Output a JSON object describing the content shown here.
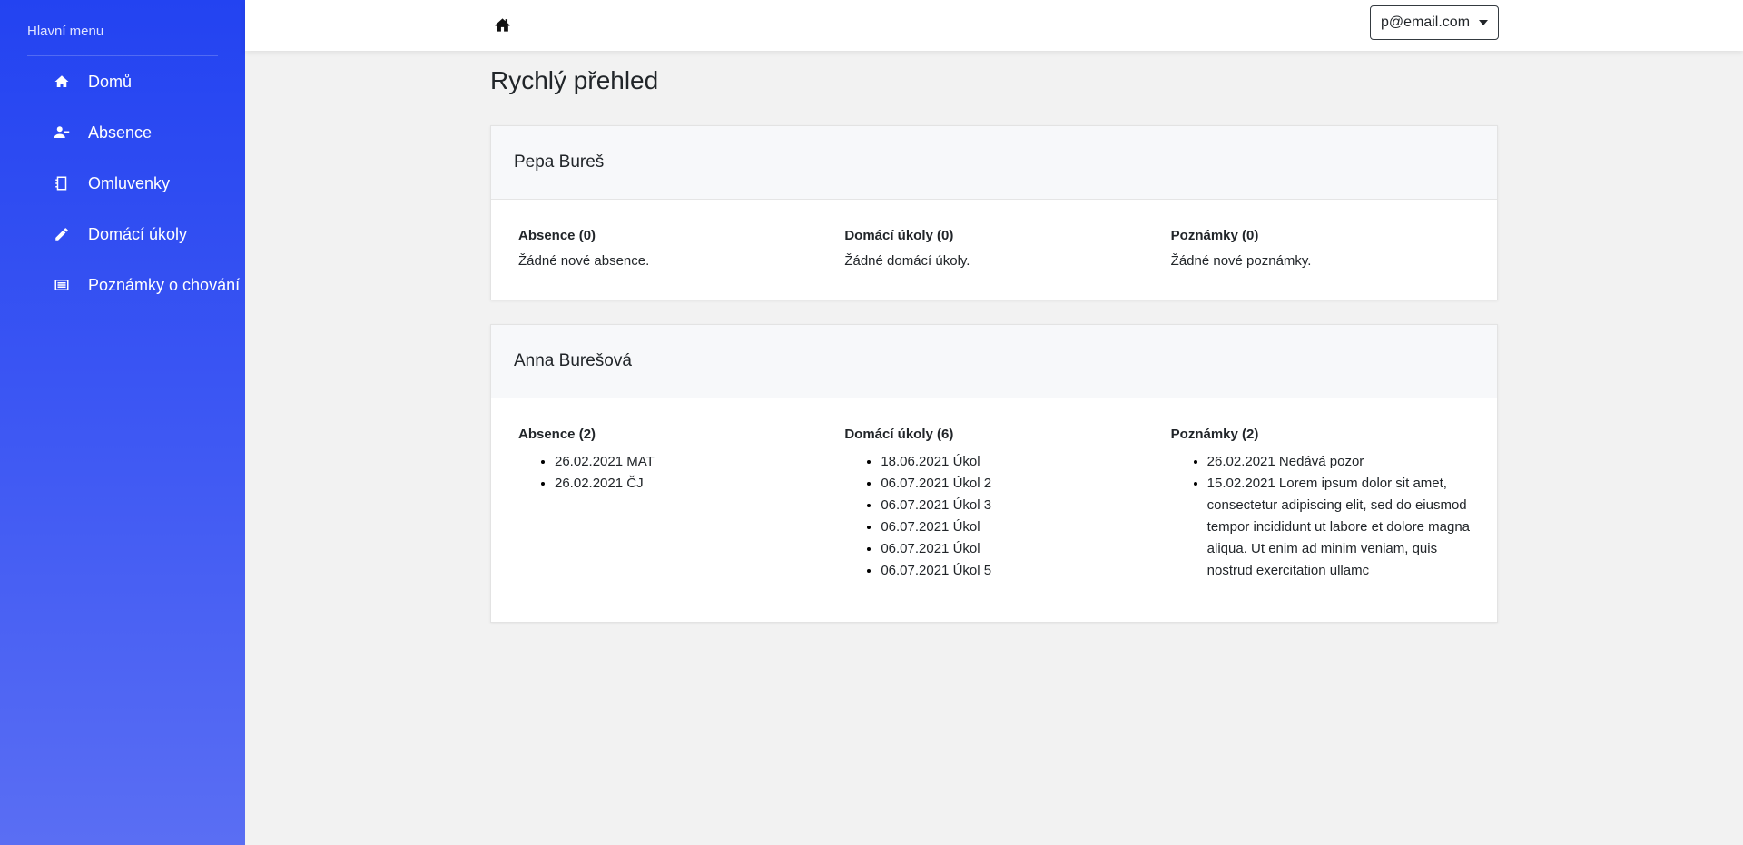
{
  "sidebar": {
    "title": "Hlavní menu",
    "items": [
      {
        "label": "Domů",
        "icon": "home-icon"
      },
      {
        "label": "Absence",
        "icon": "user-minus-icon"
      },
      {
        "label": "Omluvenky",
        "icon": "notebook-icon"
      },
      {
        "label": "Domácí úkoly",
        "icon": "pencil-icon"
      },
      {
        "label": "Poznámky o chování",
        "icon": "list-icon"
      }
    ]
  },
  "topbar": {
    "home_icon": "home-icon",
    "user_email": "p@email.com"
  },
  "main": {
    "title": "Rychlý přehled",
    "students": [
      {
        "name": "Pepa Bureš",
        "absence": {
          "heading": "Absence (0)",
          "empty": "Žádné nové absence.",
          "items": []
        },
        "homework": {
          "heading": "Domácí úkoly (0)",
          "empty": "Žádné domácí úkoly.",
          "items": []
        },
        "notes": {
          "heading": "Poznámky (0)",
          "empty": "Žádné nové poznámky.",
          "items": []
        }
      },
      {
        "name": "Anna Burešová",
        "absence": {
          "heading": "Absence (2)",
          "items": [
            "26.02.2021 MAT",
            "26.02.2021 ČJ"
          ]
        },
        "homework": {
          "heading": "Domácí úkoly (6)",
          "items": [
            "18.06.2021 Úkol",
            "06.07.2021 Úkol 2",
            "06.07.2021 Úkol 3",
            "06.07.2021 Úkol",
            "06.07.2021 Úkol",
            "06.07.2021 Úkol 5"
          ]
        },
        "notes": {
          "heading": "Poznámky (2)",
          "items": [
            "26.02.2021 Nedává pozor",
            "15.02.2021 Lorem ipsum dolor sit amet, consectetur adipiscing elit, sed do eiusmod tempor incididunt ut labore et dolore magna aliqua. Ut enim ad minim veniam, quis nostrud exercitation ullamc"
          ]
        }
      }
    ]
  },
  "colors": {
    "sidebar_top": "#2343f1",
    "sidebar_bottom": "#5a6ef3",
    "background": "#f2f2f2",
    "card_header_bg": "#f7f8fa"
  }
}
